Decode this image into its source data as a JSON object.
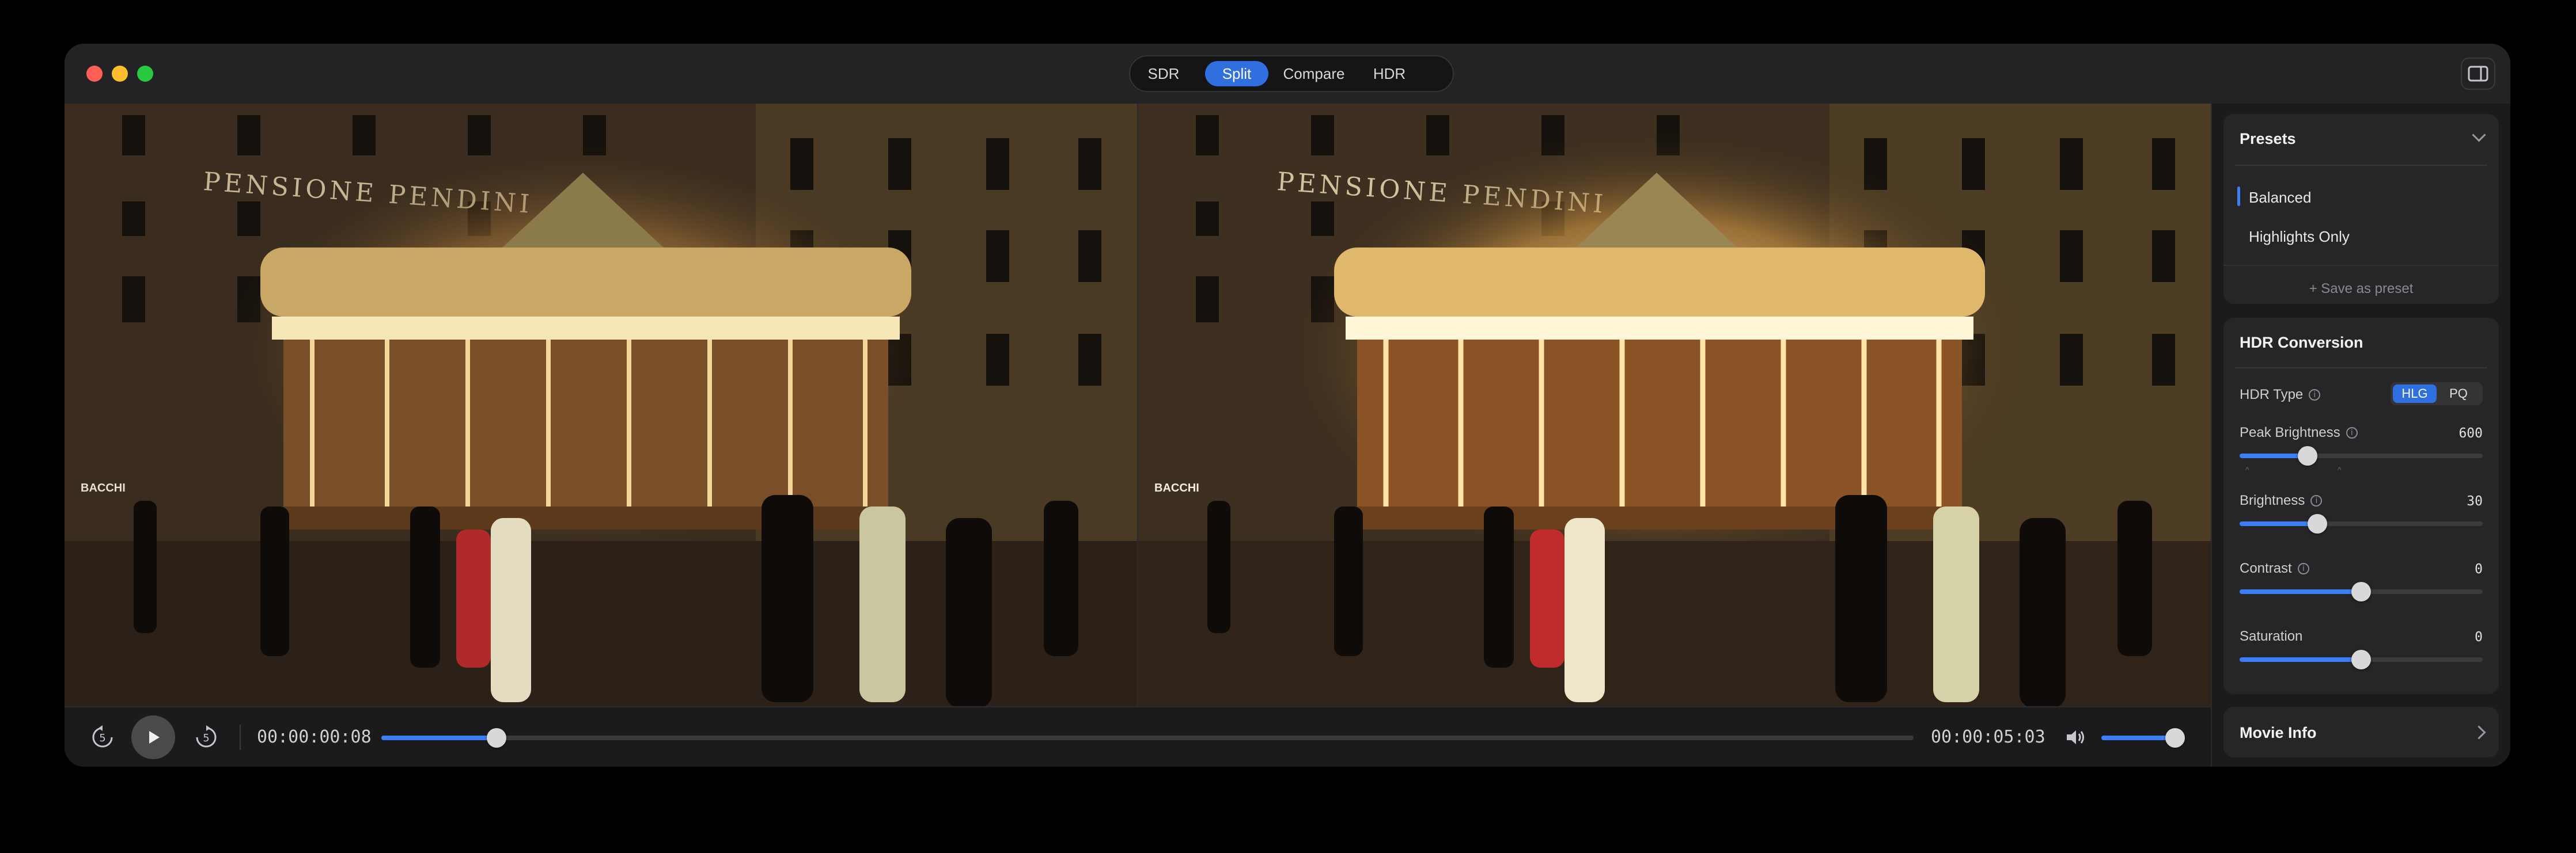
{
  "mode_tabs": [
    {
      "label": "SDR",
      "selected": false
    },
    {
      "label": "Split",
      "selected": true
    },
    {
      "label": "Compare",
      "selected": false
    },
    {
      "label": "HDR",
      "selected": false
    }
  ],
  "photo": {
    "sign_text": "PENSIONE PENDINI",
    "store_sign": "BACCHI"
  },
  "transport": {
    "current_time": "00:00:00:08",
    "total_time": "00:00:05:03",
    "progress": 0.075,
    "volume": 0.9
  },
  "presets": {
    "title": "Presets",
    "items": [
      {
        "label": "Balanced",
        "selected": true
      },
      {
        "label": "Highlights Only",
        "selected": false
      }
    ],
    "save_label": "Save as preset"
  },
  "hdr_conversion": {
    "title": "HDR Conversion",
    "hdr_type_label": "HDR Type",
    "hdr_type_options": [
      "HLG",
      "PQ"
    ],
    "hdr_type_selected": "HLG",
    "controls": [
      {
        "label": "Peak Brightness",
        "value": "600",
        "level": 0.28,
        "info": true
      },
      {
        "label": "Brightness",
        "value": "30",
        "level": 0.32,
        "info": true
      },
      {
        "label": "Contrast",
        "value": "0",
        "level": 0.5,
        "info": true
      },
      {
        "label": "Saturation",
        "value": "0",
        "level": 0.5,
        "info": false
      }
    ]
  },
  "movie_info": {
    "title": "Movie Info"
  },
  "colors": {
    "accent": "#3c7ff5",
    "window": "#1e1e20",
    "panel": "#262628"
  }
}
